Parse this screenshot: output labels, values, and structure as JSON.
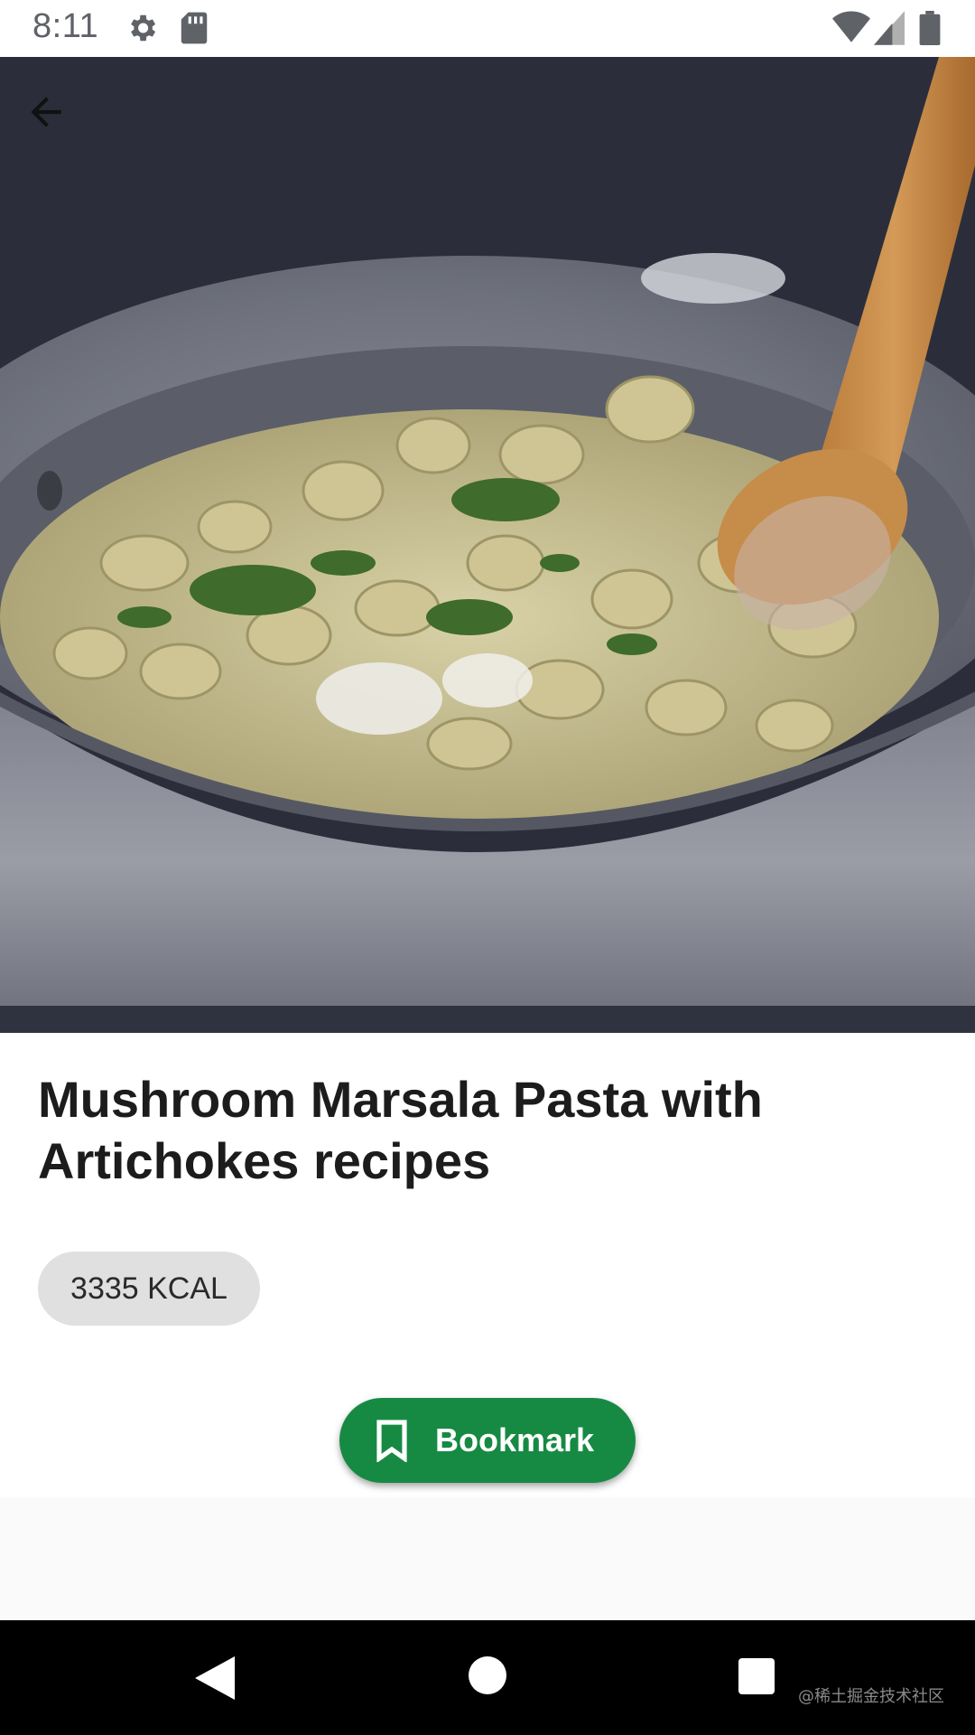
{
  "status_bar": {
    "time": "8:11",
    "left_icons": [
      "gear-icon",
      "sd-card-icon"
    ],
    "right_icons": [
      "wifi-icon",
      "cell-signal-icon",
      "battery-icon"
    ]
  },
  "hero": {
    "image": "pasta-pot-photo",
    "back_icon": "arrow-back-icon"
  },
  "recipe": {
    "title": "Mushroom Marsala Pasta with Artichokes recipes",
    "calories": "3335 KCAL"
  },
  "bookmark": {
    "label": "Bookmark",
    "icon": "bookmark-icon",
    "color": "#168a43"
  },
  "nav_bar": {
    "buttons": [
      "back-triangle-icon",
      "home-circle-icon",
      "recents-square-icon"
    ],
    "watermark": "@稀土掘金技术社区"
  }
}
